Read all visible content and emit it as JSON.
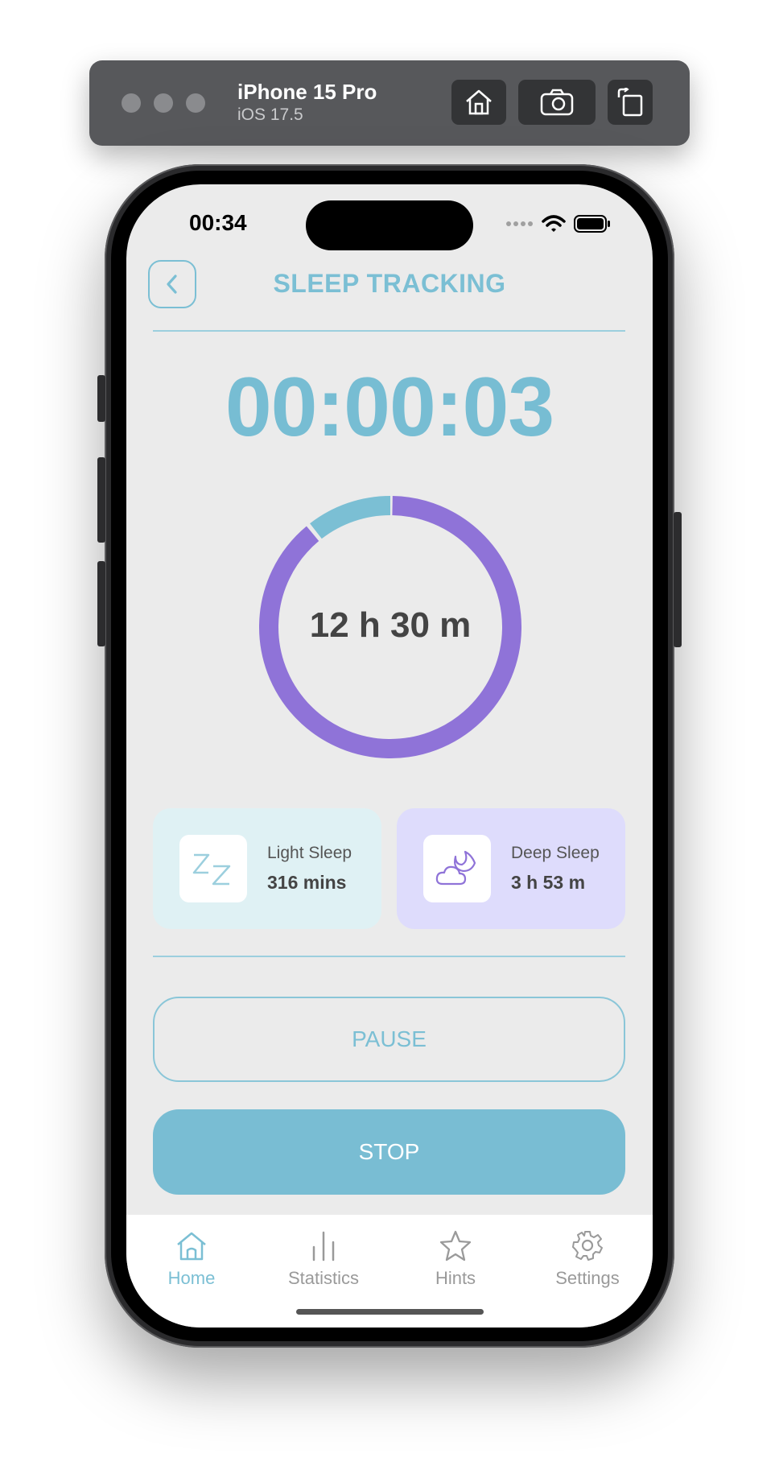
{
  "simulator": {
    "device_name": "iPhone 15 Pro",
    "os_version": "iOS 17.5",
    "buttons": [
      "home-icon",
      "camera-icon",
      "rotate-icon"
    ]
  },
  "status_bar": {
    "time": "00:34",
    "icons": [
      "signal-icon",
      "wifi-icon",
      "battery-icon"
    ]
  },
  "header": {
    "title": "SLEEP TRACKING",
    "back_icon": "chevron-left-icon"
  },
  "timer": {
    "value": "00:00:03"
  },
  "ring": {
    "center_label": "12 h 30 m",
    "colors": {
      "primary": "#8f73d8",
      "secondary": "#7bbfd4"
    },
    "secondary_fraction": 0.105
  },
  "cards": {
    "light": {
      "label": "Light Sleep",
      "value": "316 mins",
      "icon": "zz-icon"
    },
    "deep": {
      "label": "Deep Sleep",
      "value": "3 h 53 m",
      "icon": "cloud-moon-icon"
    }
  },
  "buttons": {
    "pause": "PAUSE",
    "stop": "STOP"
  },
  "tabbar": {
    "active_color": "#7bbfd4",
    "inactive_color": "#9a9a9a",
    "tabs": [
      {
        "label": "Home",
        "icon": "home-icon",
        "active": true
      },
      {
        "label": "Statistics",
        "icon": "bar-chart-icon",
        "active": false
      },
      {
        "label": "Hints",
        "icon": "star-icon",
        "active": false
      },
      {
        "label": "Settings",
        "icon": "gear-icon",
        "active": false
      }
    ]
  }
}
